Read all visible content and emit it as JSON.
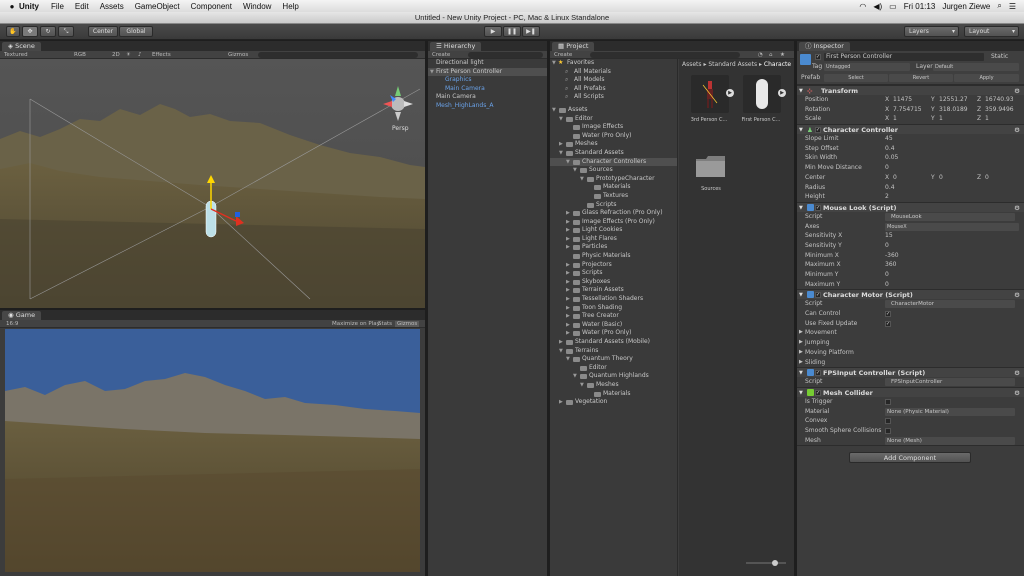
{
  "menubar": {
    "app": "Unity",
    "items": [
      "File",
      "Edit",
      "Assets",
      "GameObject",
      "Component",
      "Window",
      "Help"
    ],
    "clock": "Fri 01:13",
    "user": "Jurgen Ziewe"
  },
  "window": {
    "title": "Untitled - New Unity Project - PC, Mac & Linux Standalone"
  },
  "toolbar": {
    "center": "Center",
    "global": "Global",
    "layers": "Layers",
    "layout": "Layout"
  },
  "scene": {
    "tab": "Scene",
    "textured": "Textured",
    "rgb": "RGB",
    "mode2d": "2D",
    "effects": "Effects",
    "gizmos": "Gizmos",
    "persp": "Persp"
  },
  "game": {
    "tab": "Game",
    "aspect": "16:9",
    "maximize": "Maximize on Play",
    "stats": "Stats",
    "gizmos": "Gizmos"
  },
  "hierarchy": {
    "tab": "Hierarchy",
    "create": "Create",
    "items": [
      {
        "label": "Directional light",
        "indent": 0,
        "sel": false,
        "blue": false,
        "arrow": ""
      },
      {
        "label": "First Person Controller",
        "indent": 0,
        "sel": true,
        "blue": false,
        "arrow": "▼"
      },
      {
        "label": "Graphics",
        "indent": 1,
        "sel": false,
        "blue": true,
        "arrow": ""
      },
      {
        "label": "Main Camera",
        "indent": 1,
        "sel": false,
        "blue": true,
        "arrow": ""
      },
      {
        "label": "Main Camera",
        "indent": 0,
        "sel": false,
        "blue": false,
        "arrow": ""
      },
      {
        "label": "Mesh_HighLands_A",
        "indent": 0,
        "sel": false,
        "blue": true,
        "arrow": ""
      }
    ]
  },
  "project": {
    "tab": "Project",
    "create": "Create",
    "favorites": {
      "label": "Favorites",
      "items": [
        "All Materials",
        "All Models",
        "All Prefabs",
        "All Scripts"
      ]
    },
    "tree": [
      {
        "label": "Assets",
        "indent": 0,
        "arrow": "▼"
      },
      {
        "label": "Editor",
        "indent": 1,
        "arrow": "▼"
      },
      {
        "label": "Image Effects",
        "indent": 2,
        "arrow": ""
      },
      {
        "label": "Water (Pro Only)",
        "indent": 2,
        "arrow": ""
      },
      {
        "label": "Meshes",
        "indent": 1,
        "arrow": "▶"
      },
      {
        "label": "Standard Assets",
        "indent": 1,
        "arrow": "▼"
      },
      {
        "label": "Character Controllers",
        "indent": 2,
        "arrow": "▼",
        "sel": true
      },
      {
        "label": "Sources",
        "indent": 3,
        "arrow": "▼"
      },
      {
        "label": "PrototypeCharacter",
        "indent": 4,
        "arrow": "▼"
      },
      {
        "label": "Materials",
        "indent": 5,
        "arrow": ""
      },
      {
        "label": "Textures",
        "indent": 5,
        "arrow": ""
      },
      {
        "label": "Scripts",
        "indent": 4,
        "arrow": ""
      },
      {
        "label": "Glass Refraction (Pro Only)",
        "indent": 2,
        "arrow": "▶"
      },
      {
        "label": "Image Effects (Pro Only)",
        "indent": 2,
        "arrow": "▶"
      },
      {
        "label": "Light Cookies",
        "indent": 2,
        "arrow": "▶"
      },
      {
        "label": "Light Flares",
        "indent": 2,
        "arrow": "▶"
      },
      {
        "label": "Particles",
        "indent": 2,
        "arrow": "▶"
      },
      {
        "label": "Physic Materials",
        "indent": 2,
        "arrow": ""
      },
      {
        "label": "Projectors",
        "indent": 2,
        "arrow": "▶"
      },
      {
        "label": "Scripts",
        "indent": 2,
        "arrow": "▶"
      },
      {
        "label": "Skyboxes",
        "indent": 2,
        "arrow": "▶"
      },
      {
        "label": "Terrain Assets",
        "indent": 2,
        "arrow": "▶"
      },
      {
        "label": "Tessellation Shaders",
        "indent": 2,
        "arrow": "▶"
      },
      {
        "label": "Toon Shading",
        "indent": 2,
        "arrow": "▶"
      },
      {
        "label": "Tree Creator",
        "indent": 2,
        "arrow": "▶"
      },
      {
        "label": "Water (Basic)",
        "indent": 2,
        "arrow": "▶"
      },
      {
        "label": "Water (Pro Only)",
        "indent": 2,
        "arrow": "▶"
      },
      {
        "label": "Standard Assets (Mobile)",
        "indent": 1,
        "arrow": "▶"
      },
      {
        "label": "Terrains",
        "indent": 1,
        "arrow": "▼"
      },
      {
        "label": "Quantum Theory",
        "indent": 2,
        "arrow": "▼"
      },
      {
        "label": "Editor",
        "indent": 3,
        "arrow": ""
      },
      {
        "label": "Quantum Highlands",
        "indent": 3,
        "arrow": "▼"
      },
      {
        "label": "Meshes",
        "indent": 4,
        "arrow": "▼"
      },
      {
        "label": "Materials",
        "indent": 5,
        "arrow": ""
      },
      {
        "label": "Vegetation",
        "indent": 1,
        "arrow": "▶"
      }
    ],
    "breadcrumb": [
      "Assets",
      "Standard Assets",
      "Characte"
    ],
    "assets": [
      {
        "label": "3rd Person C..."
      },
      {
        "label": "First Person C..."
      },
      {
        "label": "Sources"
      }
    ]
  },
  "inspector": {
    "tab": "Inspector",
    "object_name": "First Person Controller",
    "static": "Static",
    "tag_label": "Tag",
    "tag_value": "Untagged",
    "layer_label": "Layer",
    "layer_value": "Default",
    "prefab_label": "Prefab",
    "prefab_select": "Select",
    "prefab_revert": "Revert",
    "prefab_apply": "Apply",
    "transform": {
      "title": "Transform",
      "position": {
        "label": "Position",
        "x": "11475",
        "y": "12551.27",
        "z": "16740.93"
      },
      "rotation": {
        "label": "Rotation",
        "x": "7.754715",
        "y": "318.0189",
        "z": "359.9496"
      },
      "scale": {
        "label": "Scale",
        "x": "1",
        "y": "1",
        "z": "1"
      }
    },
    "character_controller": {
      "title": "Character Controller",
      "rows": [
        {
          "k": "Slope Limit",
          "v": "45"
        },
        {
          "k": "Step Offset",
          "v": "0.4"
        },
        {
          "k": "Skin Width",
          "v": "0.05"
        },
        {
          "k": "Min Move Distance",
          "v": "0"
        }
      ],
      "center": {
        "label": "Center",
        "x": "0",
        "y": "0",
        "z": "0"
      },
      "radius": {
        "k": "Radius",
        "v": "0.4"
      },
      "height": {
        "k": "Height",
        "v": "2"
      }
    },
    "mouse_look": {
      "title": "Mouse Look (Script)",
      "script_label": "Script",
      "script_value": "MouseLook",
      "axes_label": "Axes",
      "axes_value": "MouseX",
      "rows": [
        {
          "k": "Sensitivity X",
          "v": "15"
        },
        {
          "k": "Sensitivity Y",
          "v": "0"
        },
        {
          "k": "Minimum X",
          "v": "-360"
        },
        {
          "k": "Maximum X",
          "v": "360"
        },
        {
          "k": "Minimum Y",
          "v": "0"
        },
        {
          "k": "Maximum Y",
          "v": "0"
        }
      ]
    },
    "character_motor": {
      "title": "Character Motor (Script)",
      "script_label": "Script",
      "script_value": "CharacterMotor",
      "can_control": "Can Control",
      "fixed_update": "Use Fixed Update",
      "sections": [
        "Movement",
        "Jumping",
        "Moving Platform",
        "Sliding"
      ]
    },
    "fps_input": {
      "title": "FPSInput Controller (Script)",
      "script_label": "Script",
      "script_value": "FPSInputController"
    },
    "mesh_collider": {
      "title": "Mesh Collider",
      "is_trigger": "Is Trigger",
      "material_label": "Material",
      "material_value": "None (Physic Material)",
      "convex": "Convex",
      "smooth": "Smooth Sphere Collisions",
      "mesh_label": "Mesh",
      "mesh_value": "None (Mesh)"
    },
    "add_component": "Add Component"
  },
  "colors": {
    "accent": "#6aa2e8",
    "panel": "#3c3c3c",
    "sky": "#3a5f9a"
  }
}
